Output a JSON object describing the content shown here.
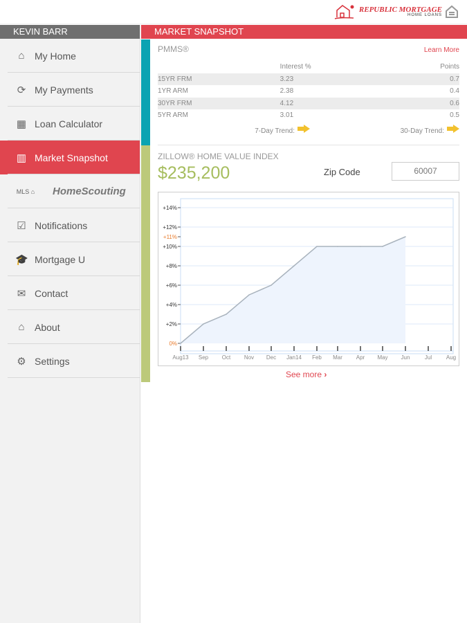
{
  "brand": {
    "name": "REPUBLIC MORTGAGE",
    "sub": "HOME LOANS"
  },
  "sidebar": {
    "user": "KEVIN BARR",
    "items": [
      {
        "label": "My Home",
        "icon": "home-icon",
        "glyph": "⌂"
      },
      {
        "label": "My Payments",
        "icon": "refresh-icon",
        "glyph": "⟳"
      },
      {
        "label": "Loan Calculator",
        "icon": "calculator-icon",
        "glyph": "▦"
      },
      {
        "label": "Market Snapshot",
        "icon": "map-icon",
        "glyph": "▥"
      },
      {
        "label": "HomeScouting",
        "icon": "homescouting-logo",
        "glyph": "MLS ⌂"
      },
      {
        "label": "Notifications",
        "icon": "checkbox-icon",
        "glyph": "☑"
      },
      {
        "label": "Mortgage U",
        "icon": "graduation-cap-icon",
        "glyph": "🎓"
      },
      {
        "label": "Contact",
        "icon": "envelope-icon",
        "glyph": "✉"
      },
      {
        "label": "About",
        "icon": "house-logo-icon",
        "glyph": "⌂"
      },
      {
        "label": "Settings",
        "icon": "gear-icon",
        "glyph": "⚙"
      }
    ]
  },
  "header": {
    "title": "MARKET SNAPSHOT"
  },
  "pmms": {
    "title": "PMMS®",
    "learn_more": "Learn More",
    "col_interest": "Interest %",
    "col_points": "Points",
    "rows": [
      [
        "15YR FRM",
        "3.23",
        "0.7"
      ],
      [
        "1YR ARM",
        "2.38",
        "0.4"
      ],
      [
        "30YR FRM",
        "4.12",
        "0.6"
      ],
      [
        "5YR ARM",
        "3.01",
        "0.5"
      ]
    ],
    "trend7": "7-Day Trend:",
    "trend30": "30-Day Trend:"
  },
  "zillow": {
    "title": "ZILLOW® HOME VALUE INDEX",
    "value": "$235,200",
    "zip_label": "Zip Code",
    "zip": "60007"
  },
  "see_more": "See more",
  "colors": {
    "accent": "#e0454f",
    "teal": "#0aa3b2",
    "green": "#bcc97a",
    "arrow": "#f2c12e"
  },
  "chart_data": {
    "type": "area",
    "x": [
      "Aug13",
      "Sep",
      "Oct",
      "Nov",
      "Dec",
      "Jan14",
      "Feb",
      "Mar",
      "Apr",
      "May",
      "Jun",
      "Jul",
      "Aug"
    ],
    "values": [
      0,
      2,
      3,
      5,
      6,
      8,
      10,
      10,
      10,
      10,
      11
    ],
    "yticks": [
      "0%",
      "+2%",
      "+4%",
      "+6%",
      "+8%",
      "+10%",
      "+11%",
      "+12%",
      "+14%"
    ],
    "ytick_values": [
      0,
      2,
      4,
      6,
      8,
      10,
      11,
      12,
      14
    ],
    "ylim": [
      0,
      15
    ],
    "highlight": [
      "0%",
      "+11%"
    ]
  }
}
